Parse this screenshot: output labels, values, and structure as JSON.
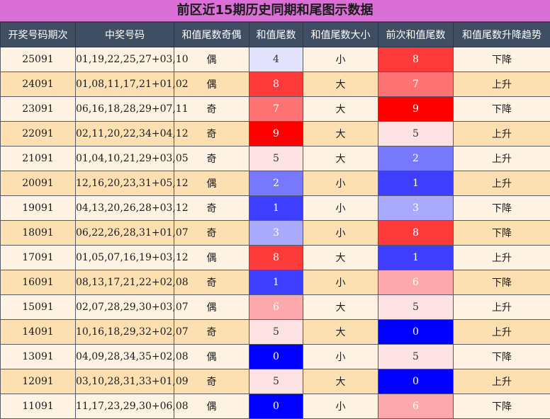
{
  "title": "前区近15期历史同期和尾图示数据",
  "headers": [
    "开奖号码期次",
    "中奖号码",
    "和值尾数奇偶",
    "和值尾数",
    "和值尾数大小",
    "前次和值尾数",
    "和值尾数升降趋势"
  ],
  "heat_colors": {
    "0": "#0000ff",
    "1": "#3e3efe",
    "2": "#7878fc",
    "3": "#aaaafc",
    "4": "#e2e2fc",
    "5": "#fde2e4",
    "6": "#fca8ac",
    "7": "#fd7272",
    "8": "#fd3a3a",
    "9": "#ff0000"
  },
  "rows": [
    {
      "period": "25091",
      "numbers": "01,19,22,25,27+03,10",
      "parity": "偶",
      "tail": "4",
      "size": "小",
      "prev_tail": "8",
      "trend": "下降"
    },
    {
      "period": "24091",
      "numbers": "01,08,11,17,21+01,02",
      "parity": "偶",
      "tail": "8",
      "size": "大",
      "prev_tail": "7",
      "trend": "上升"
    },
    {
      "period": "23091",
      "numbers": "06,16,18,28,29+07,11",
      "parity": "奇",
      "tail": "7",
      "size": "大",
      "prev_tail": "9",
      "trend": "下降"
    },
    {
      "period": "22091",
      "numbers": "02,11,20,22,34+04,12",
      "parity": "奇",
      "tail": "9",
      "size": "大",
      "prev_tail": "5",
      "trend": "上升"
    },
    {
      "period": "21091",
      "numbers": "01,04,10,21,29+03,05",
      "parity": "奇",
      "tail": "5",
      "size": "大",
      "prev_tail": "2",
      "trend": "上升"
    },
    {
      "period": "20091",
      "numbers": "12,16,20,23,31+05,12",
      "parity": "偶",
      "tail": "2",
      "size": "小",
      "prev_tail": "1",
      "trend": "上升"
    },
    {
      "period": "19091",
      "numbers": "04,13,20,26,28+03,12",
      "parity": "奇",
      "tail": "1",
      "size": "小",
      "prev_tail": "3",
      "trend": "下降"
    },
    {
      "period": "18091",
      "numbers": "06,22,26,28,31+01,07",
      "parity": "奇",
      "tail": "3",
      "size": "小",
      "prev_tail": "8",
      "trend": "下降"
    },
    {
      "period": "17091",
      "numbers": "01,05,07,16,19+03,12",
      "parity": "偶",
      "tail": "8",
      "size": "大",
      "prev_tail": "1",
      "trend": "上升"
    },
    {
      "period": "16091",
      "numbers": "08,13,17,21,22+02,08",
      "parity": "奇",
      "tail": "1",
      "size": "小",
      "prev_tail": "6",
      "trend": "下降"
    },
    {
      "period": "15091",
      "numbers": "02,07,28,29,30+03,07",
      "parity": "偶",
      "tail": "6",
      "size": "大",
      "prev_tail": "5",
      "trend": "上升"
    },
    {
      "period": "14091",
      "numbers": "10,16,18,29,32+02,07",
      "parity": "奇",
      "tail": "5",
      "size": "大",
      "prev_tail": "0",
      "trend": "上升"
    },
    {
      "period": "13091",
      "numbers": "04,09,28,34,35+02,08",
      "parity": "偶",
      "tail": "0",
      "size": "小",
      "prev_tail": "5",
      "trend": "下降"
    },
    {
      "period": "12091",
      "numbers": "03,10,28,31,33+01,09",
      "parity": "奇",
      "tail": "5",
      "size": "大",
      "prev_tail": "0",
      "trend": "上升"
    },
    {
      "period": "11091",
      "numbers": "11,17,23,29,30+06,08",
      "parity": "偶",
      "tail": "0",
      "size": "小",
      "prev_tail": "6",
      "trend": "下降"
    }
  ]
}
